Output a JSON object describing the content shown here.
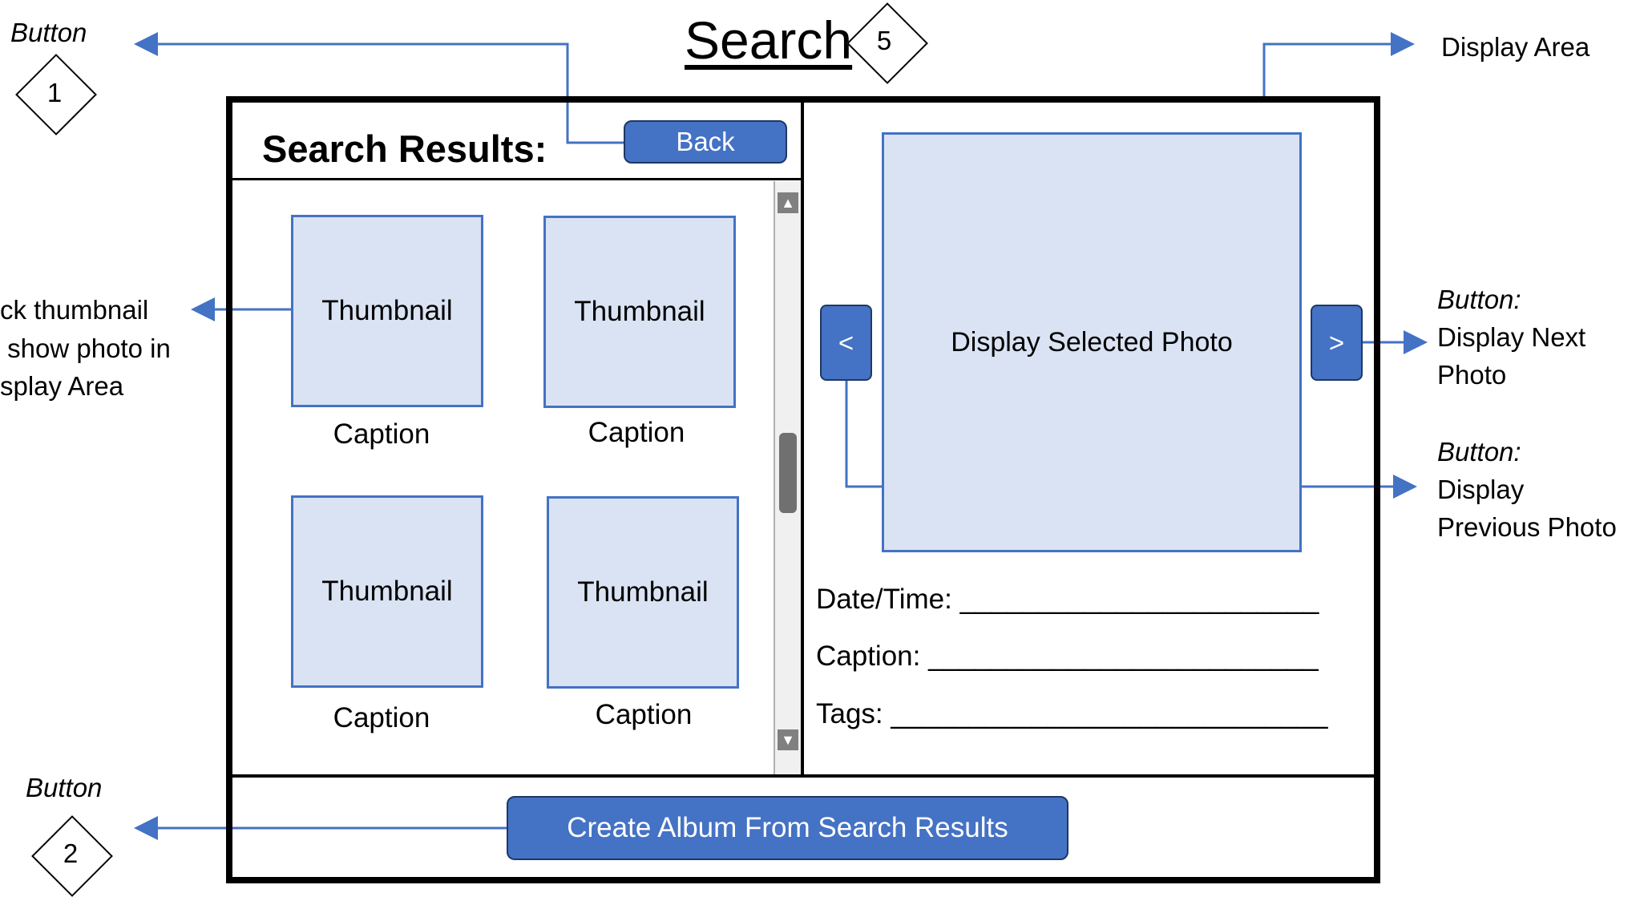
{
  "title": "Search",
  "title_number": "5",
  "annotations": {
    "button1_label": "Button",
    "button1_number": "1",
    "button2_label": "Button",
    "button2_number": "2",
    "display_area": "Display Area",
    "thumbnail_note_line1": "ck thumbnail",
    "thumbnail_note_line2": " show photo in",
    "thumbnail_note_line3": "splay Area",
    "next_label": "Button:",
    "next_desc_line1": "Display Next",
    "next_desc_line2": "Photo",
    "prev_label": "Button:",
    "prev_desc_line1": "Display",
    "prev_desc_line2": "Previous Photo"
  },
  "left_panel": {
    "heading": "Search Results:",
    "back_button": "Back",
    "thumbnails": [
      {
        "label": "Thumbnail",
        "caption": "Caption"
      },
      {
        "label": "Thumbnail",
        "caption": "Caption"
      },
      {
        "label": "Thumbnail",
        "caption": "Caption"
      },
      {
        "label": "Thumbnail",
        "caption": "Caption"
      }
    ]
  },
  "right_panel": {
    "display_text": "Display Selected Photo",
    "prev_button": "<",
    "next_button": ">",
    "fields": [
      {
        "label": "Date/Time: _______________________"
      },
      {
        "label": "Caption: _________________________"
      },
      {
        "label": "Tags: ____________________________"
      }
    ]
  },
  "footer": {
    "create_album_button": "Create Album From Search Results"
  },
  "colors": {
    "accent": "#4472c4",
    "thumb_fill": "#dae3f3",
    "button_border": "#1f3864"
  }
}
